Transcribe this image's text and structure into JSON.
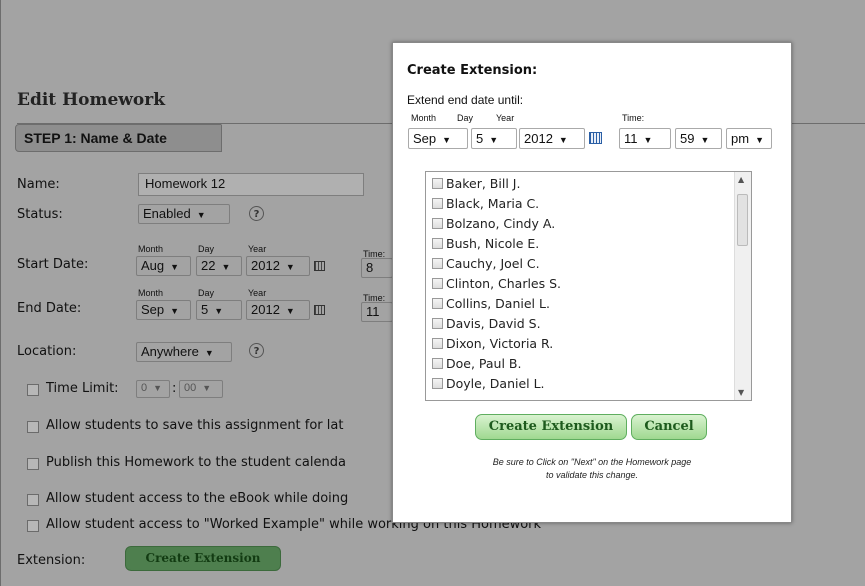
{
  "page": {
    "title": "Edit Homework",
    "step_label": "STEP 1: Name & Date",
    "name_label": "Name:",
    "name_value": "Homework 12",
    "status_label": "Status:",
    "status_value": "Enabled",
    "start_label": "Start Date:",
    "end_label": "End Date:",
    "date_headers": {
      "month": "Month",
      "day": "Day",
      "year": "Year",
      "time": "Time:"
    },
    "start": {
      "month": "Aug",
      "day": "22",
      "year": "2012",
      "hour": "8"
    },
    "end": {
      "month": "Sep",
      "day": "5",
      "year": "2012",
      "hour": "11"
    },
    "location_label": "Location:",
    "location_value": "Anywhere",
    "time_limit_label": "Time Limit:",
    "time_limit_hours": "0",
    "time_limit_sep": ":",
    "time_limit_minutes": "00",
    "options": [
      "Allow students to save this assignment for lat",
      "Publish this Homework to the student calenda",
      "Allow student access to the eBook while doing",
      "Allow student access to \"Worked Example\" while working on this Homework"
    ],
    "extension_label": "Extension:",
    "extension_button": "Create Extension"
  },
  "modal": {
    "title": "Create Extension:",
    "subtitle": "Extend end date until:",
    "headers": {
      "month": "Month",
      "day": "Day",
      "year": "Year",
      "time": "Time:"
    },
    "month": "Sep",
    "day": "5",
    "year": "2012",
    "hour": "11",
    "minute": "59",
    "ampm": "pm",
    "students": [
      "Baker, Bill J.",
      "Black, Maria C.",
      "Bolzano, Cindy A.",
      "Bush, Nicole E.",
      "Cauchy, Joel C.",
      "Clinton, Charles S.",
      "Collins, Daniel L.",
      "Davis, David S.",
      "Dixon, Victoria R.",
      "Doe, Paul B.",
      "Doyle, Daniel L."
    ],
    "create_button": "Create Extension",
    "cancel_button": "Cancel",
    "note_line1": "Be sure to Click on \"Next\" on the Homework page",
    "note_line2": "to validate this change."
  }
}
